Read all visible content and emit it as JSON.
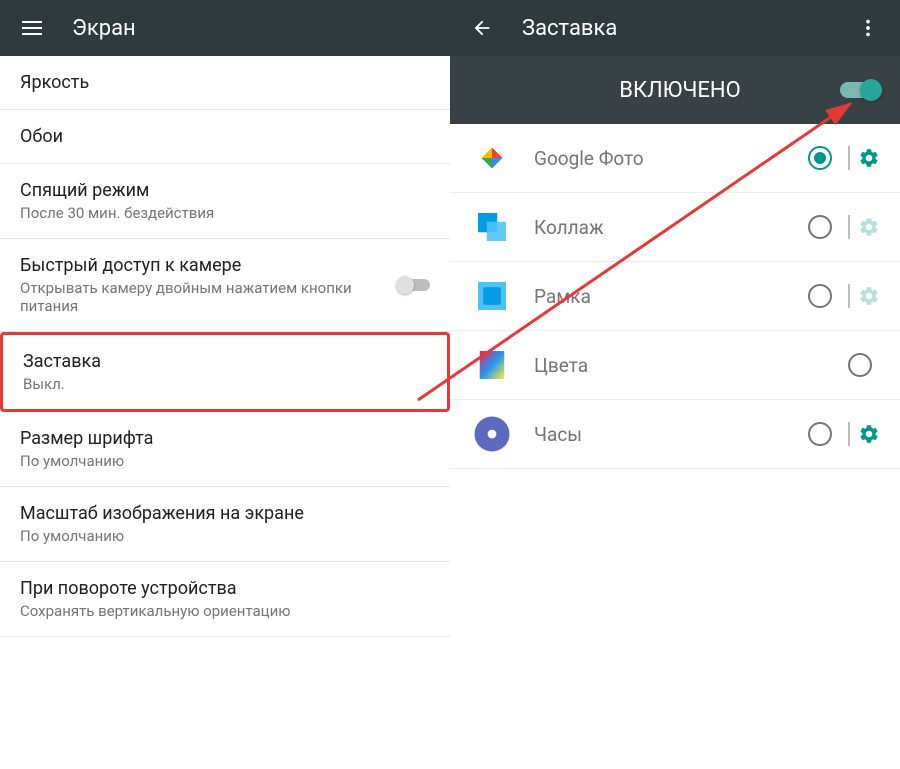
{
  "left": {
    "title": "Экран",
    "items": [
      {
        "title": "Яркость",
        "sub": ""
      },
      {
        "title": "Обои",
        "sub": ""
      },
      {
        "title": "Спящий режим",
        "sub": "После 30 мин. бездействия"
      },
      {
        "title": "Быстрый доступ к камере",
        "sub": "Открывать камеру двойным нажатием кнопки питания",
        "toggle": true
      },
      {
        "title": "Заставка",
        "sub": "Выкл.",
        "highlight": true
      },
      {
        "title": "Размер шрифта",
        "sub": "По умолчанию"
      },
      {
        "title": "Масштаб изображения на экране",
        "sub": "По умолчанию"
      },
      {
        "title": "При повороте устройства",
        "sub": "Сохранять вертикальную ориентацию"
      }
    ]
  },
  "right": {
    "title": "Заставка",
    "status_label": "ВКЛЮЧЕНО",
    "items": [
      {
        "label": "Google Фото",
        "icon": "photos",
        "selected": true,
        "settings": true
      },
      {
        "label": "Коллаж",
        "icon": "collage",
        "selected": false,
        "settings": true,
        "muted": true
      },
      {
        "label": "Рамка",
        "icon": "frame",
        "selected": false,
        "settings": true,
        "muted": true
      },
      {
        "label": "Цвета",
        "icon": "colors",
        "selected": false,
        "settings": false
      },
      {
        "label": "Часы",
        "icon": "clock",
        "selected": false,
        "settings": true
      }
    ]
  }
}
